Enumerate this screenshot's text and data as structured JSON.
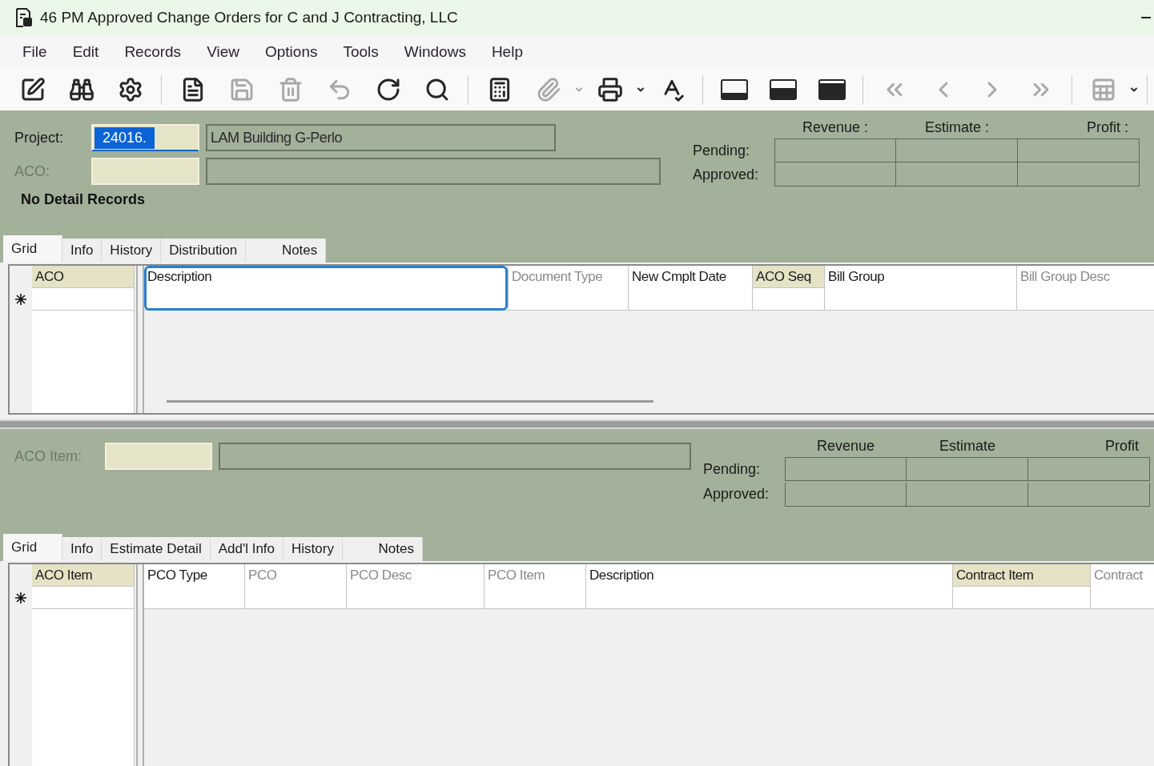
{
  "window": {
    "title": "46 PM Approved Change Orders for C and J Contracting, LLC"
  },
  "menu": [
    "File",
    "Edit",
    "Records",
    "View",
    "Options",
    "Tools",
    "Windows",
    "Help"
  ],
  "toolbar": [
    {
      "kind": "edit",
      "disabled": false
    },
    {
      "kind": "find",
      "disabled": false
    },
    {
      "kind": "tools",
      "disabled": false
    },
    {
      "kind": "separator"
    },
    {
      "kind": "document",
      "disabled": false
    },
    {
      "kind": "save",
      "disabled": true
    },
    {
      "kind": "delete",
      "disabled": true
    },
    {
      "kind": "undo",
      "disabled": true
    },
    {
      "kind": "refresh",
      "disabled": false
    },
    {
      "kind": "search",
      "disabled": false
    },
    {
      "kind": "separator"
    },
    {
      "kind": "calculator",
      "disabled": false
    },
    {
      "kind": "attach",
      "disabled": true
    },
    {
      "kind": "dropdown",
      "disabled": true
    },
    {
      "kind": "print",
      "disabled": false
    },
    {
      "kind": "dropdown",
      "disabled": false
    },
    {
      "kind": "spellcheck",
      "disabled": false
    },
    {
      "kind": "separator"
    },
    {
      "kind": "layout1",
      "disabled": false
    },
    {
      "kind": "layout2",
      "disabled": false
    },
    {
      "kind": "layout3",
      "disabled": false
    },
    {
      "kind": "separator"
    },
    {
      "kind": "first",
      "disabled": true
    },
    {
      "kind": "previous",
      "disabled": true
    },
    {
      "kind": "next",
      "disabled": true
    },
    {
      "kind": "last",
      "disabled": true
    },
    {
      "kind": "separator"
    },
    {
      "kind": "gridsettings",
      "disabled": true
    },
    {
      "kind": "dropdown",
      "disabled": false
    },
    {
      "kind": "separator"
    }
  ],
  "sections": [
    {
      "fields": [
        {
          "label": "Project:",
          "disabled": false,
          "value": "24016.",
          "highlighted": true,
          "description": "LAM Building G-Perlo"
        },
        {
          "label": "ACO:",
          "disabled": true,
          "highlighted": false
        }
      ],
      "message": "No Detail Records",
      "summary": {
        "columns": [
          "Revenue :",
          "Estimate :",
          "Profit :"
        ],
        "rows": [
          "Pending:",
          "Approved:"
        ]
      },
      "tabs": [
        {
          "label": "Grid",
          "selected": true
        },
        {
          "label": "Info",
          "selected": false
        },
        {
          "label": "History",
          "selected": false
        },
        {
          "label": "Distribution",
          "selected": false
        },
        {
          "label": "Notes",
          "selected": false
        }
      ],
      "grid": {
        "frozen_columns": [
          {
            "label": "ACO",
            "kind": "key",
            "focused": false
          }
        ],
        "columns": [
          {
            "label": "Description",
            "kind": "plain",
            "focused": true
          },
          {
            "label": "Document Type",
            "kind": "readonly",
            "focused": false
          },
          {
            "label": "New Cmplt Date",
            "kind": "plain",
            "focused": false
          },
          {
            "label": "ACO Seq",
            "kind": "key",
            "focused": false
          },
          {
            "label": "Bill Group",
            "kind": "plain",
            "focused": false
          },
          {
            "label": "Bill Group Desc",
            "kind": "readonly",
            "focused": false
          }
        ]
      }
    },
    {
      "fields": [
        {
          "label": "ACO Item:",
          "disabled": true,
          "highlighted": false
        }
      ],
      "summary": {
        "columns": [
          "Revenue",
          "Estimate",
          "Profit"
        ],
        "rows": [
          "Pending:",
          "Approved:"
        ]
      },
      "tabs": [
        {
          "label": "Grid",
          "selected": true
        },
        {
          "label": "Info",
          "selected": false
        },
        {
          "label": "Estimate Detail",
          "selected": false
        },
        {
          "label": "Add'l Info",
          "selected": false
        },
        {
          "label": "History",
          "selected": false
        },
        {
          "label": "Notes",
          "selected": false
        }
      ],
      "grid": {
        "frozen_columns": [
          {
            "label": "ACO Item",
            "kind": "key",
            "focused": false
          }
        ],
        "columns": [
          {
            "label": "PCO Type",
            "kind": "plain",
            "focused": false
          },
          {
            "label": "PCO",
            "kind": "readonly",
            "focused": false
          },
          {
            "label": "PCO Desc",
            "kind": "readonly",
            "focused": false
          },
          {
            "label": "PCO Item",
            "kind": "readonly",
            "focused": false
          },
          {
            "label": "Description",
            "kind": "plain",
            "focused": false
          },
          {
            "label": "Contract Item",
            "kind": "key",
            "focused": false
          },
          {
            "label": "Contract",
            "kind": "readonly",
            "focused": false
          }
        ]
      }
    }
  ]
}
